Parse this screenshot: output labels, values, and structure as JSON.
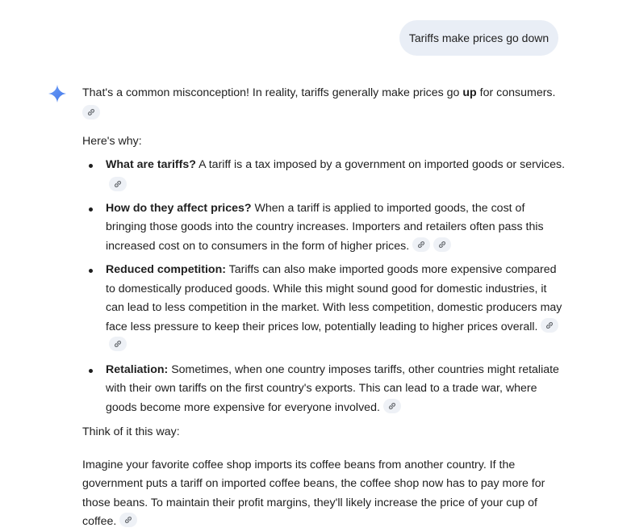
{
  "user_message": "Tariffs make prices go down",
  "response": {
    "intro_before": "That's a common misconception! In reality, tariffs generally make prices go ",
    "intro_bold": "up",
    "intro_after": " for consumers.",
    "why": "Here's why:",
    "points": [
      {
        "title": "What are tariffs?",
        "text": " A tariff is a tax imposed by a government on imported goods or services."
      },
      {
        "title": "How do they affect prices?",
        "text": " When a tariff is applied to imported goods, the cost of bringing those goods into the country increases. Importers and retailers often pass this increased cost on to consumers in the form of higher prices."
      },
      {
        "title": "Reduced competition:",
        "text": " Tariffs can also make imported goods more expensive compared to domestically produced goods. While this might sound good for domestic industries, it can lead to less competition in the market. With less competition, domestic producers may face less pressure to keep their prices low, potentially leading to higher prices overall."
      },
      {
        "title": "Retaliation:",
        "text": " Sometimes, when one country imposes tariffs, other countries might retaliate with their own tariffs on the first country's exports. This can lead to a trade war, where goods become more expensive for everyone involved."
      }
    ],
    "think": "Think of it this way:",
    "analogy": "Imagine your favorite coffee shop imports its coffee beans from another country. If the government puts a tariff on imported coffee beans, the coffee shop now has to pay more for those beans. To maintain their profit margins, they'll likely increase the price of your cup of coffee."
  },
  "icons": {
    "assistant": "gemini-spark-icon",
    "citation": "link-icon"
  },
  "colors": {
    "user_bubble": "#e9eef6",
    "citation_chip": "#eef1f6",
    "spark_blue": "#4a86f0",
    "text": "#1f1f1f"
  }
}
